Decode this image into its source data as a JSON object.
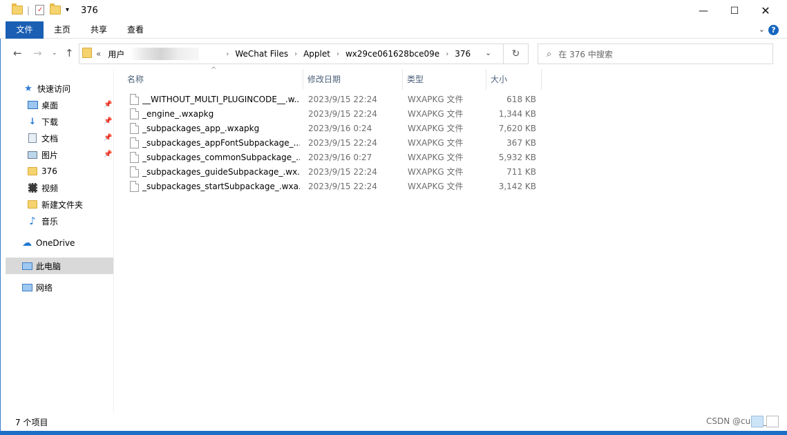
{
  "window": {
    "title": "376",
    "controls": {
      "minimize": "—",
      "maximize": "☐",
      "close": "✕"
    }
  },
  "ribbon": {
    "tabs": [
      "文件",
      "主页",
      "共享",
      "查看"
    ],
    "help": "?"
  },
  "address": {
    "overflow": "«",
    "crumbs": [
      "用户",
      "WeChat Files",
      "Applet",
      "wx29ce061628bce09e",
      "376"
    ]
  },
  "search": {
    "placeholder": "在 376 中搜索"
  },
  "navpane": {
    "quick_access": "快速访问",
    "items": [
      {
        "label": "桌面",
        "icon": "desktop-icon",
        "pinned": true
      },
      {
        "label": "下载",
        "icon": "download-icon",
        "pinned": true
      },
      {
        "label": "文档",
        "icon": "documents-icon",
        "pinned": true
      },
      {
        "label": "图片",
        "icon": "pictures-icon",
        "pinned": true
      },
      {
        "label": "376",
        "icon": "folder-icon",
        "pinned": false
      },
      {
        "label": "视频",
        "icon": "videos-icon",
        "pinned": false
      },
      {
        "label": "新建文件夹",
        "icon": "folder-icon",
        "pinned": false
      },
      {
        "label": "音乐",
        "icon": "music-icon",
        "pinned": false
      }
    ],
    "onedrive": "OneDrive",
    "this_pc": "此电脑",
    "network": "网络"
  },
  "columns": {
    "name": "名称",
    "date": "修改日期",
    "type": "类型",
    "size": "大小"
  },
  "files": [
    {
      "name": "__WITHOUT_MULTI_PLUGINCODE__.w...",
      "date": "2023/9/15 22:24",
      "type": "WXAPKG 文件",
      "size": "618 KB"
    },
    {
      "name": "_engine_.wxapkg",
      "date": "2023/9/15 22:24",
      "type": "WXAPKG 文件",
      "size": "1,344 KB"
    },
    {
      "name": "_subpackages_app_.wxapkg",
      "date": "2023/9/16 0:24",
      "type": "WXAPKG 文件",
      "size": "7,620 KB"
    },
    {
      "name": "_subpackages_appFontSubpackage_....",
      "date": "2023/9/15 22:24",
      "type": "WXAPKG 文件",
      "size": "367 KB"
    },
    {
      "name": "_subpackages_commonSubpackage_...",
      "date": "2023/9/16 0:27",
      "type": "WXAPKG 文件",
      "size": "5,932 KB"
    },
    {
      "name": "_subpackages_guideSubpackage_.wx...",
      "date": "2023/9/15 22:24",
      "type": "WXAPKG 文件",
      "size": "711 KB"
    },
    {
      "name": "_subpackages_startSubpackage_.wxa...",
      "date": "2023/9/15 22:24",
      "type": "WXAPKG 文件",
      "size": "3,142 KB"
    }
  ],
  "status": {
    "count": "7 个项目",
    "watermark": "CSDN @curry_wu"
  },
  "colors": {
    "accent": "#1a5fb4",
    "selection": "#d9d9d9",
    "folder": "#f5d36e"
  }
}
